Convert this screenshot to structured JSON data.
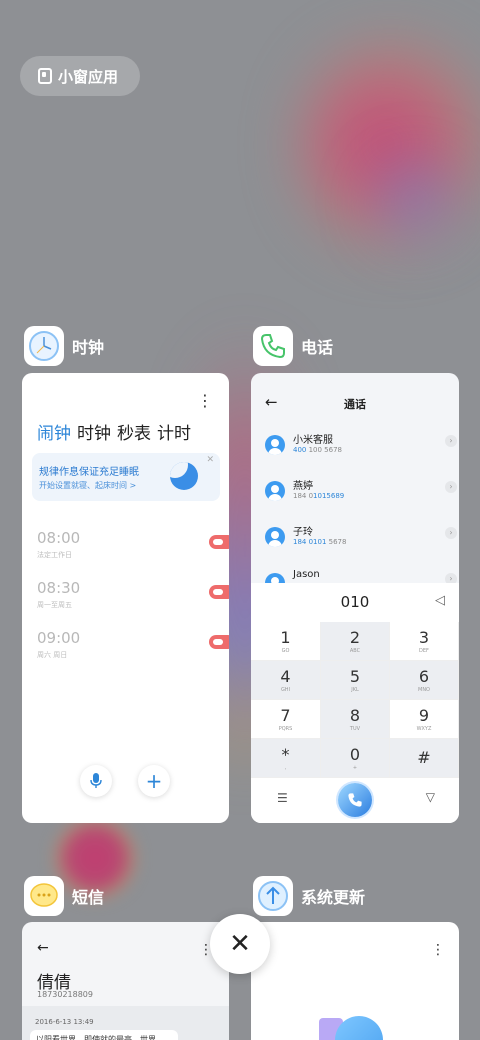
{
  "mini_window": {
    "label": "小窗应用"
  },
  "apps": {
    "clock": {
      "name": "时钟",
      "tabs": [
        "闹钟",
        "时钟",
        "秒表",
        "计时"
      ],
      "banner": {
        "title": "规律作息保证充足睡眠",
        "subtitle": "开始设置就寝、起床时间 >"
      },
      "alarms": [
        {
          "time": "08:00",
          "repeat": "法定工作日"
        },
        {
          "time": "08:30",
          "repeat": "周一至周五"
        },
        {
          "time": "09:00",
          "repeat": "周六 周日"
        }
      ]
    },
    "phone": {
      "name": "电话",
      "title": "通话",
      "contacts": [
        {
          "name": "小米客服",
          "number_hl": "400",
          "number_rest": " 100 5678"
        },
        {
          "name": "燕婷",
          "number_hl": "184 0",
          "number_rest": "1015689"
        },
        {
          "name": "子玲",
          "number_hl": "184 0101",
          "number_rest": " 5678"
        },
        {
          "name": "Jason",
          "number_hl": "",
          "number_rest": ""
        }
      ],
      "dial_input": "010",
      "keys": [
        {
          "d": "1",
          "l": "GO"
        },
        {
          "d": "2",
          "l": "ABC"
        },
        {
          "d": "3",
          "l": "DEF"
        },
        {
          "d": "4",
          "l": "GHI"
        },
        {
          "d": "5",
          "l": "JKL"
        },
        {
          "d": "6",
          "l": "MNO"
        },
        {
          "d": "7",
          "l": "PQRS"
        },
        {
          "d": "8",
          "l": "TUV"
        },
        {
          "d": "9",
          "l": "WXYZ"
        },
        {
          "d": "*",
          "l": ","
        },
        {
          "d": "0",
          "l": "+"
        },
        {
          "d": "#",
          "l": ""
        }
      ]
    },
    "sms": {
      "name": "短信",
      "contact_name": "倩倩",
      "contact_number": "18730218809",
      "date": "2016-6-13 13:49",
      "message": "以阳看世界，即使就的最亮，世界"
    },
    "update": {
      "name": "系统更新"
    }
  },
  "close_label": "✕"
}
